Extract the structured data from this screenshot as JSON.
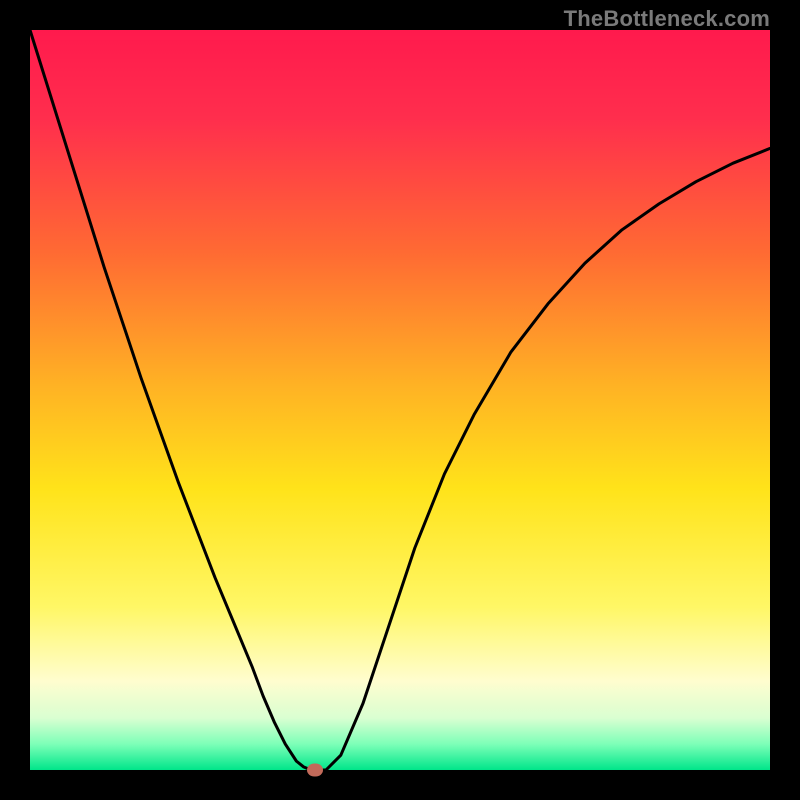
{
  "watermark": "TheBottleneck.com",
  "chart_data": {
    "type": "line",
    "title": "",
    "xlabel": "",
    "ylabel": "",
    "xlim": [
      0,
      100
    ],
    "ylim": [
      0,
      100
    ],
    "grid": false,
    "legend": false,
    "gradient_stops": [
      {
        "pos": 0.0,
        "color": "#ff1a4d"
      },
      {
        "pos": 0.12,
        "color": "#ff2e4d"
      },
      {
        "pos": 0.3,
        "color": "#ff6a33"
      },
      {
        "pos": 0.48,
        "color": "#ffb224"
      },
      {
        "pos": 0.62,
        "color": "#ffe31a"
      },
      {
        "pos": 0.78,
        "color": "#fff766"
      },
      {
        "pos": 0.88,
        "color": "#fffdcf"
      },
      {
        "pos": 0.93,
        "color": "#d9ffd1"
      },
      {
        "pos": 0.965,
        "color": "#7dffb8"
      },
      {
        "pos": 1.0,
        "color": "#00e68a"
      }
    ],
    "series": [
      {
        "name": "bottleneck-curve",
        "color": "#000000",
        "width": 3,
        "x": [
          0.0,
          2.5,
          5.0,
          7.5,
          10.0,
          12.5,
          15.0,
          17.5,
          20.0,
          22.5,
          25.0,
          27.5,
          30.0,
          31.5,
          33.0,
          34.5,
          36.0,
          37.0,
          38.0,
          40.0,
          42.0,
          45.0,
          48.0,
          52.0,
          56.0,
          60.0,
          65.0,
          70.0,
          75.0,
          80.0,
          85.0,
          90.0,
          95.0,
          100.0
        ],
        "y": [
          100.0,
          92.0,
          84.0,
          76.0,
          68.0,
          60.5,
          53.0,
          46.0,
          39.0,
          32.5,
          26.0,
          20.0,
          14.0,
          10.0,
          6.5,
          3.5,
          1.2,
          0.4,
          0.0,
          0.0,
          2.0,
          9.0,
          18.0,
          30.0,
          40.0,
          48.0,
          56.5,
          63.0,
          68.5,
          73.0,
          76.5,
          79.5,
          82.0,
          84.0
        ]
      }
    ],
    "marker": {
      "x": 38.5,
      "y": 0.0,
      "color": "#c26a5a",
      "name": "optimal-point"
    }
  }
}
